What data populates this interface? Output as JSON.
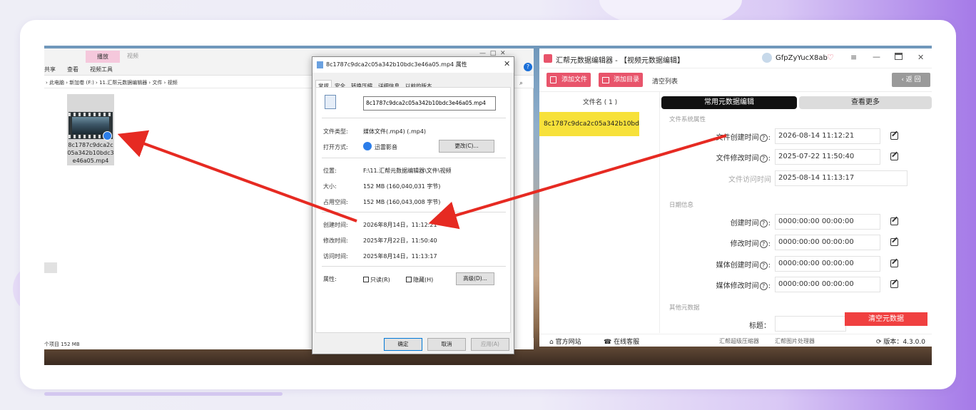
{
  "colors": {
    "accent_red": "#e8546b",
    "arrow_red": "#e62a22",
    "highlight_yellow": "#f7e13a",
    "dark_seg": "#111111",
    "clear_btn": "#f04040"
  },
  "explorer": {
    "ribbon_tab_play": "播放",
    "ribbon_tab_video": "视频",
    "ribbon_share": "共享",
    "ribbon_view": "查看",
    "ribbon_video_tools": "视频工具",
    "breadcrumb": [
      "此电脑",
      "新加卷 (F:)",
      "11.汇帮元数据编辑器",
      "文件",
      "视频"
    ],
    "file_name": "8c1787c9dca2c05a342b10bdc3e46a05.mp4",
    "status": "个项目  152 MB"
  },
  "dialog": {
    "title": "8c1787c9dca2c05a342b10bdc3e46a05.mp4 属性",
    "tabs": [
      "常规",
      "安全",
      "转换压缩",
      "详细信息",
      "以前的版本"
    ],
    "filename_value": "8c1787c9dca2c05a342b10bdc3e46a05.mp4",
    "type_label": "文件类型:",
    "type_value": "媒体文件(.mp4) (.mp4)",
    "open_label": "打开方式:",
    "open_value": "迅雷影音",
    "change_btn": "更改(C)...",
    "loc_label": "位置:",
    "loc_value": "F:\\11.汇帮元数据编辑器\\文件\\视频",
    "size_label": "大小:",
    "size_value": "152 MB (160,040,031 字节)",
    "disk_label": "占用空间:",
    "disk_value": "152 MB (160,043,008 字节)",
    "created_label": "创建时间:",
    "created_value": "2026年8月14日，11:12:21",
    "modified_label": "修改时间:",
    "modified_value": "2025年7月22日，11:50:40",
    "accessed_label": "访问时间:",
    "accessed_value": "2025年8月14日，11:13:17",
    "attr_label": "属性:",
    "readonly": "只读(R)",
    "hidden": "隐藏(H)",
    "advanced_btn": "高级(D)...",
    "ok": "确定",
    "cancel": "取消",
    "apply": "应用(A)"
  },
  "app": {
    "title": "汇帮元数据编辑器 - 【视频元数据编辑】",
    "user": "GfpZyYucX8ab",
    "add_file": "添加文件",
    "add_dir": "添加目录",
    "clear_list": "清空列表",
    "back": "返 回",
    "file_list_header": "文件名 ( 1 )",
    "file_item": "8c1787c9dca2c05a342b10bdc3e46a05.mp4",
    "seg_common": "常用元数据编辑",
    "seg_more": "查看更多",
    "section_fs": "文件系统属性",
    "fs_created_label": "文件创建时间",
    "fs_created": "2026-08-14 11:12:21",
    "fs_modified_label": "文件修改时间",
    "fs_modified": "2025-07-22 11:50:40",
    "fs_accessed_label": "文件访问时间",
    "fs_accessed": "2025-08-14 11:13:17",
    "section_date": "日期信息",
    "d_created_label": "创建时间",
    "d_created": "0000:00:00 00:00:00",
    "d_modified_label": "修改时间",
    "d_modified": "0000:00:00 00:00:00",
    "m_created_label": "媒体创建时间",
    "m_created": "0000:00:00 00:00:00",
    "m_modified_label": "媒体修改时间",
    "m_modified": "0000:00:00 00:00:00",
    "section_other": "其他元数据",
    "title_label": "标题：",
    "clear_meta": "清空元数据",
    "footer": {
      "site": "官方网站",
      "service": "在线客服",
      "compressor": "汇帮超级压缩器",
      "image_tool": "汇帮图片处理器",
      "version": "版本：",
      "version_value": "4.3.0.0"
    }
  }
}
